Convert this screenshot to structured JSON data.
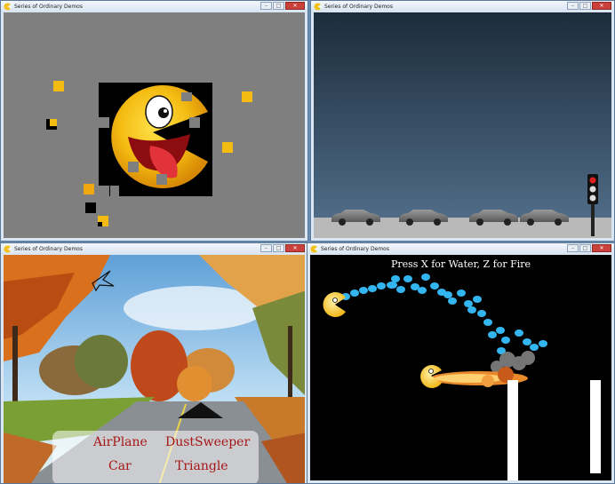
{
  "windows": [
    {
      "title": "Series of Ordinary Demos"
    },
    {
      "title": "Series of Ordinary Demos"
    },
    {
      "title": "Series of Ordinary Demos"
    },
    {
      "title": "Series of Ordinary Demos"
    }
  ],
  "window_controls": {
    "minimize": "–",
    "maximize": "□",
    "close": "✕"
  },
  "menu": {
    "airplane": "AirPlane",
    "dustsweeper": "DustSweeper",
    "car": "Car",
    "triangle": "Triangle"
  },
  "firewater": {
    "instruction": "Press X for Water, Z for Fire"
  },
  "colors": {
    "puzzle_bg": "#7f7f7f",
    "menu_text": "#a71616",
    "water": "#33b6f0",
    "fire": "#e8892c",
    "traffic_light_red": "#e02020"
  },
  "icons": [
    "app-icon",
    "minimize-icon",
    "maximize-icon",
    "close-icon"
  ]
}
